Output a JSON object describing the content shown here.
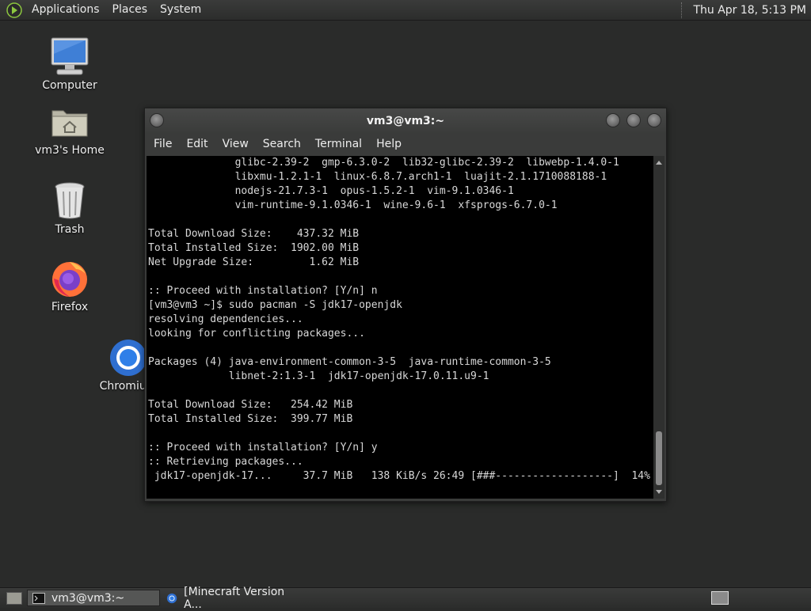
{
  "top_panel": {
    "menus": [
      "Applications",
      "Places",
      "System"
    ],
    "clock": "Thu Apr 18,  5:13 PM"
  },
  "desktop": {
    "icons": [
      {
        "label": "Computer",
        "icon": "computer-icon"
      },
      {
        "label": "vm3's Home",
        "icon": "home-folder-icon"
      },
      {
        "label": "Trash",
        "icon": "trash-icon"
      },
      {
        "label": "Firefox",
        "icon": "firefox-icon"
      },
      {
        "label": "Chromium",
        "icon": "chromium-icon"
      }
    ]
  },
  "terminal": {
    "title": "vm3@vm3:~",
    "menu": [
      "File",
      "Edit",
      "View",
      "Search",
      "Terminal",
      "Help"
    ],
    "lines": [
      "              glibc-2.39-2  gmp-6.3.0-2  lib32-glibc-2.39-2  libwebp-1.4.0-1",
      "              libxmu-1.2.1-1  linux-6.8.7.arch1-1  luajit-2.1.1710088188-1",
      "              nodejs-21.7.3-1  opus-1.5.2-1  vim-9.1.0346-1",
      "              vim-runtime-9.1.0346-1  wine-9.6-1  xfsprogs-6.7.0-1",
      "",
      "Total Download Size:    437.32 MiB",
      "Total Installed Size:  1902.00 MiB",
      "Net Upgrade Size:         1.62 MiB",
      "",
      ":: Proceed with installation? [Y/n] n",
      "[vm3@vm3 ~]$ sudo pacman -S jdk17-openjdk",
      "resolving dependencies...",
      "looking for conflicting packages...",
      "",
      "Packages (4) java-environment-common-3-5  java-runtime-common-3-5",
      "             libnet-2:1.3-1  jdk17-openjdk-17.0.11.u9-1",
      "",
      "Total Download Size:   254.42 MiB",
      "Total Installed Size:  399.77 MiB",
      "",
      ":: Proceed with installation? [Y/n] y",
      ":: Retrieving packages...",
      " jdk17-openjdk-17...     37.7 MiB   138 KiB/s 26:49 [###-------------------]  14%"
    ]
  },
  "taskbar": {
    "tasks": [
      {
        "label": "vm3@vm3:~",
        "active": true
      },
      {
        "label": "[Minecraft Version A...",
        "active": false
      }
    ]
  }
}
